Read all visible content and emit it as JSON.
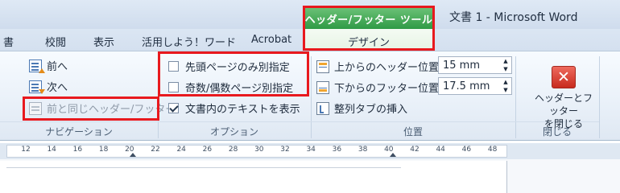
{
  "titlebar": {
    "contextual_tool_title": "ヘッダー/フッター ツール",
    "window_title": "文書 1 - Microsoft Word"
  },
  "tabs": [
    {
      "label": "書"
    },
    {
      "label": "校閲"
    },
    {
      "label": "表示"
    },
    {
      "label": "活用しよう！ワード"
    },
    {
      "label": "Acrobat"
    },
    {
      "label": "デザイン"
    }
  ],
  "navigation": {
    "prev_label": "前へ",
    "next_label": "次へ",
    "link_previous_label": "前と同じヘッダー/フッター",
    "group_label": "ナビゲーション"
  },
  "options": {
    "different_first_page": {
      "label": "先頭ページのみ別指定",
      "checked": false
    },
    "different_odd_even": {
      "label": "奇数/偶数ページ別指定",
      "checked": false
    },
    "show_document_text": {
      "label": "文書内のテキストを表示",
      "checked": true
    },
    "group_label": "オプション"
  },
  "position": {
    "header_from_top_label": "上からのヘッダー位置:",
    "header_from_top_value": "15 mm",
    "footer_from_bottom_label": "下からのフッター位置:",
    "footer_from_bottom_value": "17.5 mm",
    "insert_alignment_tab_label": "整列タブの挿入",
    "group_label": "位置"
  },
  "close": {
    "button_label": "ヘッダーとフッター\nを閉じる",
    "group_label": "閉じる"
  },
  "ruler": {
    "numbers": [
      "12",
      "14",
      "16",
      "18",
      "20",
      "22",
      "24",
      "26",
      "28",
      "30",
      "32",
      "34",
      "36",
      "38",
      "40",
      "42",
      "44",
      "46",
      "48"
    ]
  },
  "colors": {
    "highlight": "#e8191e",
    "contextual_tab": "#2f9a45",
    "close_button": "#c82b1d"
  },
  "icons": {
    "prev": "previous-section-icon",
    "next": "next-section-icon",
    "link": "link-to-previous-icon",
    "header_pos": "header-position-icon",
    "footer_pos": "footer-position-icon",
    "align_tab": "alignment-tab-icon",
    "close": "close-x-icon"
  }
}
